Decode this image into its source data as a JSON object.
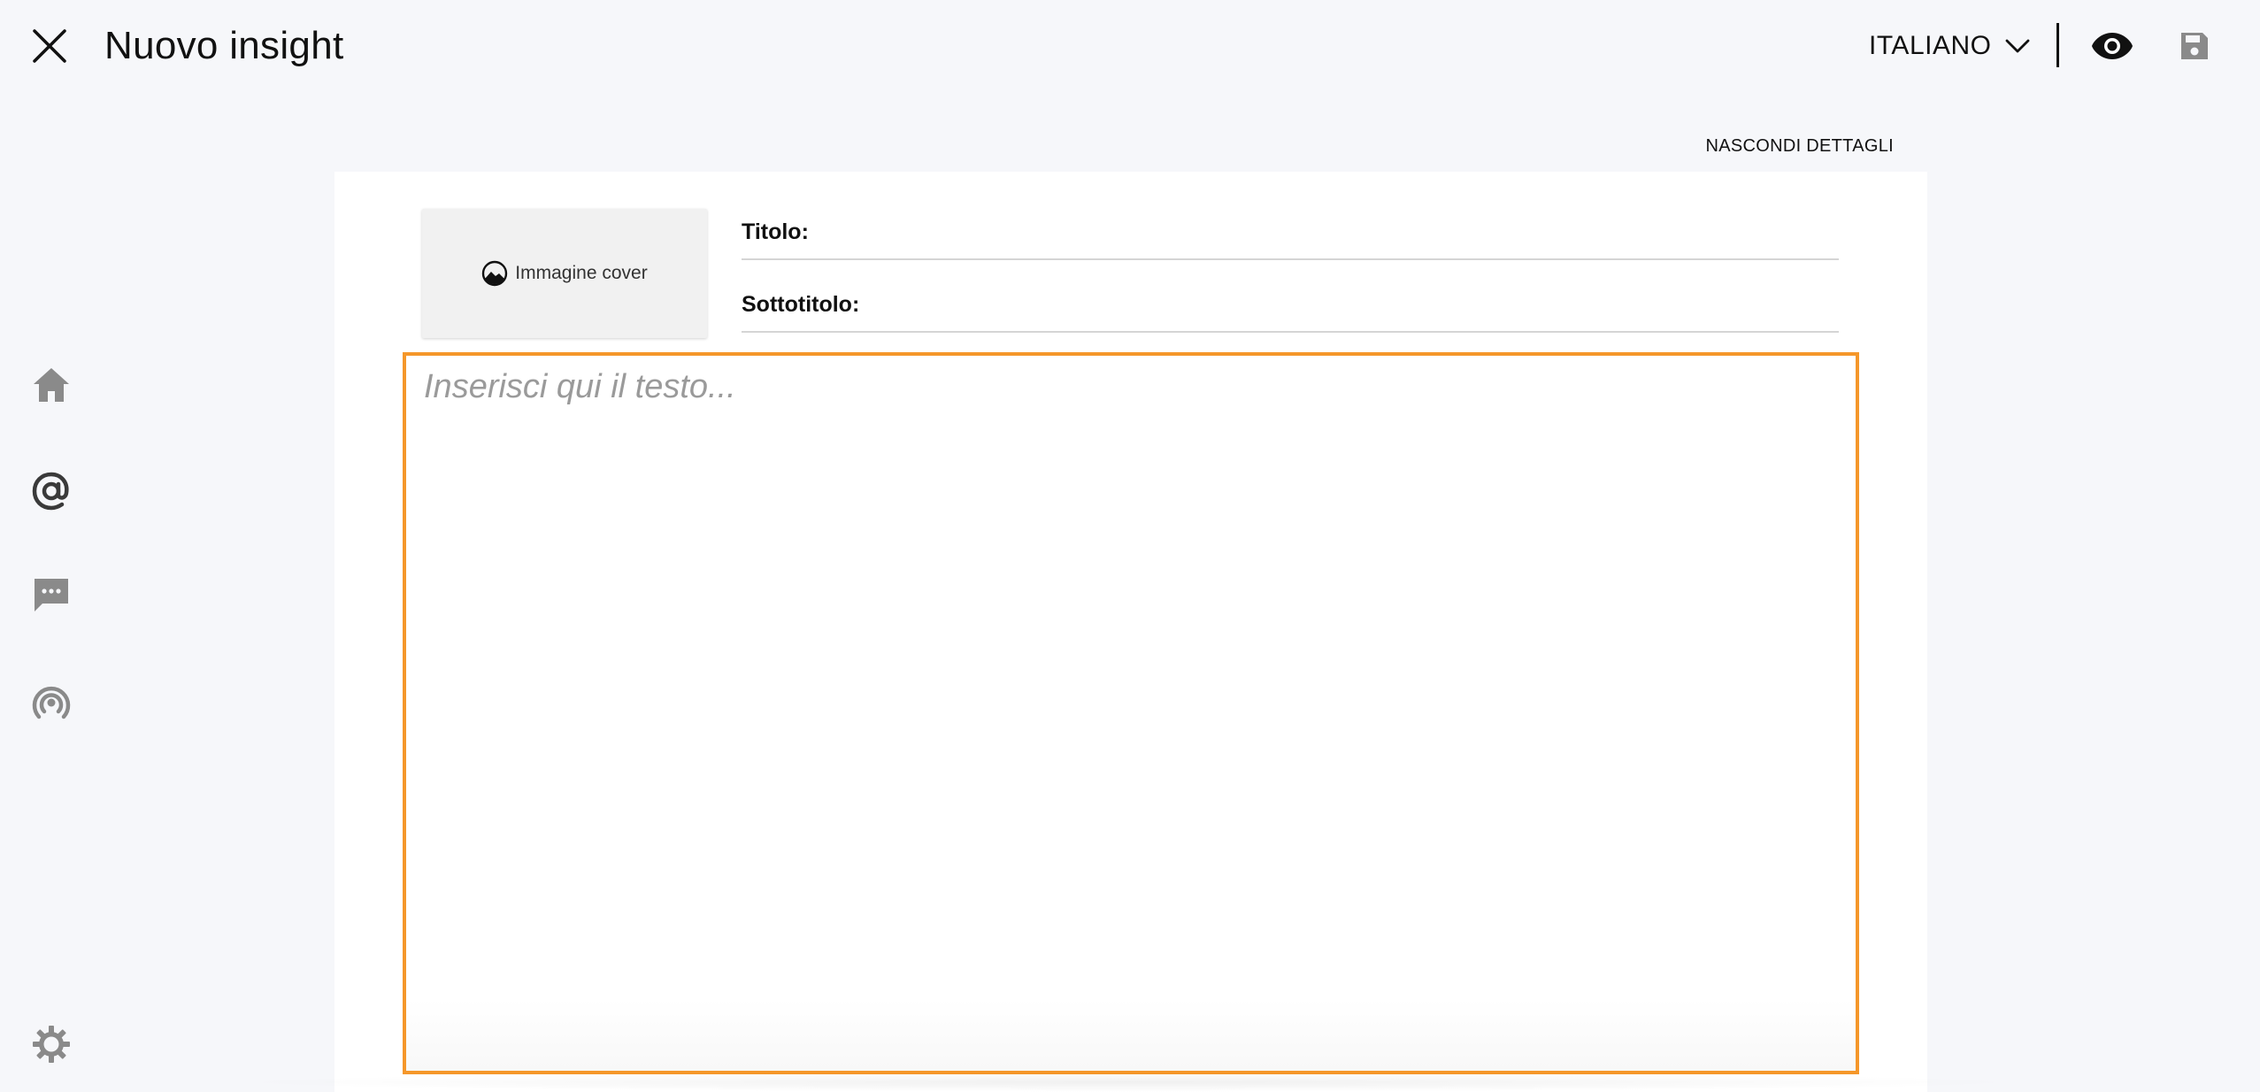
{
  "header": {
    "title": "Nuovo insight",
    "close_icon": "close-icon",
    "language": "ITALIANO",
    "language_icon": "chevron-down-icon",
    "preview_icon": "eye-icon",
    "save_icon": "save-icon"
  },
  "sidebar": {
    "items": [
      {
        "icon": "home-icon"
      },
      {
        "icon": "at-sign-icon"
      },
      {
        "icon": "chat-icon"
      },
      {
        "icon": "podcast-icon"
      }
    ],
    "settings_icon": "gear-icon"
  },
  "details": {
    "toggle_label": "NASCONDI DETTAGLI"
  },
  "form": {
    "cover_label": "Immagine cover",
    "cover_icon": "landscape-circle-icon",
    "title_label": "Titolo:",
    "subtitle_label": "Sottotitolo:"
  },
  "editor": {
    "placeholder": "Inserisci qui il testo..."
  },
  "colors": {
    "background": "#f6f7fa",
    "card": "#ffffff",
    "editor_border": "#f5972a",
    "icon_gray": "#8a8a8a",
    "placeholder": "#9a9a9a"
  }
}
